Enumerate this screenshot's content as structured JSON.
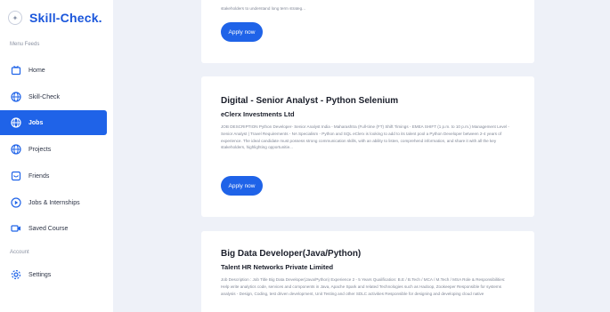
{
  "brand": {
    "name": "Skill-Check.",
    "logo_icon": "logo-badge"
  },
  "sidebar": {
    "menu_label": "Menu Feeds",
    "account_label": "Account",
    "items": [
      {
        "label": "Home",
        "icon": "home-icon"
      },
      {
        "label": "Skill-Check",
        "icon": "globe-icon"
      },
      {
        "label": "Jobs",
        "icon": "globe-icon",
        "active": true
      },
      {
        "label": "Projects",
        "icon": "globe-icon"
      },
      {
        "label": "Friends",
        "icon": "friends-icon"
      },
      {
        "label": "Jobs & Internships",
        "icon": "play-circle-icon"
      },
      {
        "label": "Saved Course",
        "icon": "video-icon"
      }
    ],
    "settings_label": "Settings"
  },
  "jobs": [
    {
      "title": "",
      "company": "",
      "description": "stakeholders to understand long term strateg...",
      "apply_label": "Apply now"
    },
    {
      "title": "Digital - Senior Analyst - Python Selenium",
      "company": "eClerx Investments Ltd",
      "description": "JOB DESCRIPTION Python Developer- Senior Analyst India - Maharashtra (Full-time (FT) Shift Timings - EMEA SHIFT (1 p.m. to 10 p.m.) Management Level - Senior Analyst | Travel Requirements - NA Specialism - Python and SQL eClerx is looking to add to its talent pool a Python Developer between 2-4 years of experience. The ideal candidate must possess strong communication skills, with an ability to listen, comprehend information, and share it with all the key stakeholders, highlighting opportunitie...",
      "apply_label": "Apply now"
    },
    {
      "title": "Big Data Developer(Java/Python)",
      "company": "Talent HR Networks Private Limited",
      "description": "Job Description : Job Title Big Data Developer(Java/Python) Experience 2 - 5 Years Qualification: B.E / B.Tech / MCA / M.Tech / MSA Role & Responsibilities: Help write analytics code, services and components in Java, Apache Spark and related Technologies such as Hadoop, Zookeeper Responsible for systems analysis - Design, Coding, test driven development, Unit Testing and other SDLC activities Responsible for designing and developing cloud native",
      "apply_label": "Apply now"
    }
  ],
  "colors": {
    "accent": "#1f63e8",
    "brand": "#1a56db",
    "background": "#eef1f8"
  }
}
